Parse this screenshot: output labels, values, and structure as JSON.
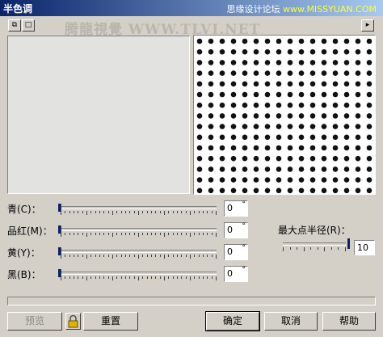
{
  "window": {
    "title": "半色调"
  },
  "watermarks": {
    "top_cn": "思缘设计论坛",
    "top_site": "www.MISSYUAN.COM",
    "middle": "腾龍視覺 WWW.TLVI.NET"
  },
  "toolbar": {
    "btn1_glyph": "⧉",
    "btn2_glyph": "□",
    "arrow_glyph": "▸"
  },
  "sliders": [
    {
      "label": "青(C)：",
      "value": "0",
      "unit": "°",
      "level": 0
    },
    {
      "label": "品红(M)：",
      "value": "0",
      "unit": "°",
      "level": 0
    },
    {
      "label": "黄(Y)：",
      "value": "0",
      "unit": "°",
      "level": 0
    },
    {
      "label": "黑(B)：",
      "value": "0",
      "unit": "°",
      "level": 0
    }
  ],
  "max_radius": {
    "label": "最大点半径(R)：",
    "value": "10",
    "level": 1
  },
  "buttons": {
    "preview": "预览",
    "reset": "重置",
    "ok": "确定",
    "cancel": "取消",
    "help": "帮助"
  },
  "icons": {
    "lock": "lock-icon"
  }
}
